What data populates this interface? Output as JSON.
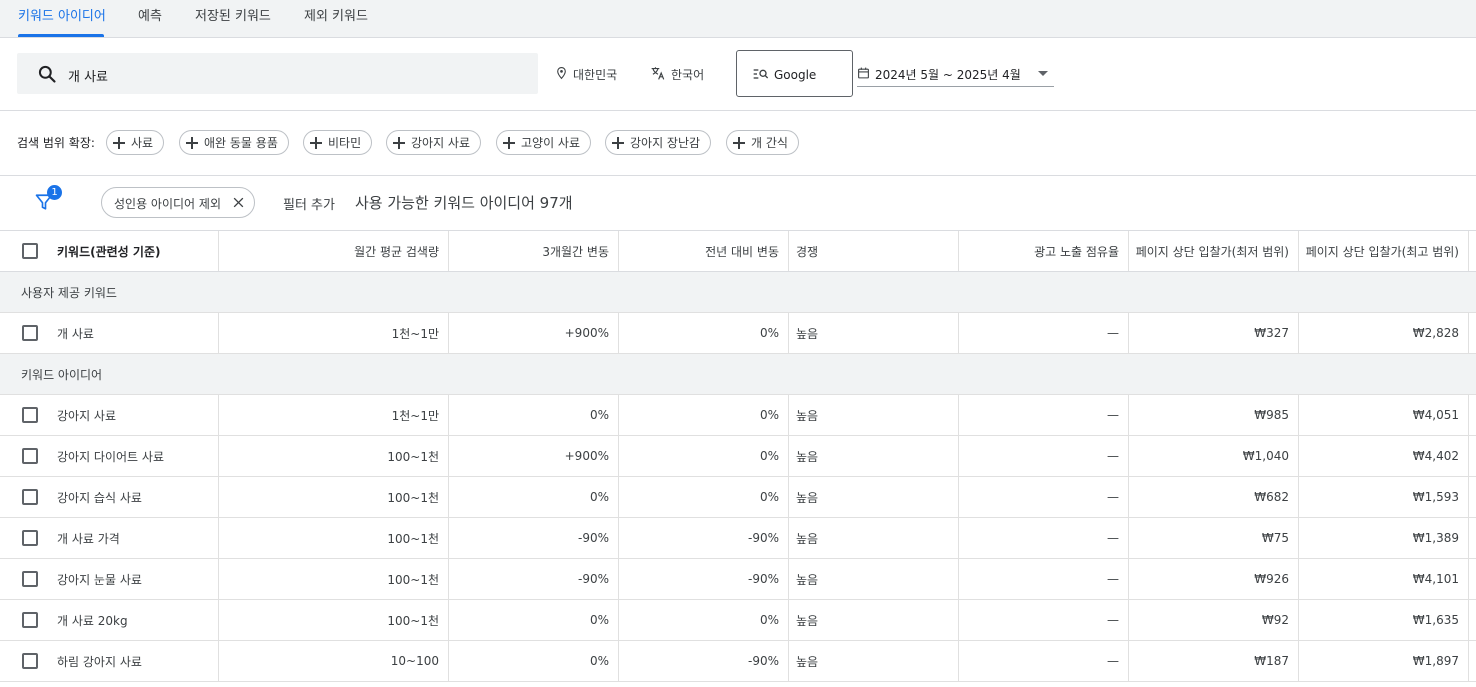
{
  "tabs": [
    {
      "label": "키워드 아이디어",
      "active": true
    },
    {
      "label": "예측",
      "active": false
    },
    {
      "label": "저장된 키워드",
      "active": false
    },
    {
      "label": "제외 키워드",
      "active": false
    }
  ],
  "search": {
    "value": "개 사료",
    "icon": "search-icon"
  },
  "location": {
    "label": "대한민국",
    "icon": "location-pin-icon"
  },
  "language": {
    "label": "한국어",
    "icon": "translate-icon"
  },
  "network": {
    "label": "Google",
    "icon": "search-list-icon"
  },
  "date_range": {
    "label": "2024년 5월 ~ 2025년 4월",
    "icon": "calendar-icon"
  },
  "expand": {
    "label": "검색 범위 확장:",
    "chips": [
      "사료",
      "애완 동물 용품",
      "비타민",
      "강아지 사료",
      "고양이 사료",
      "강아지 장난감",
      "개 간식"
    ]
  },
  "filters": {
    "count_badge": "1",
    "active_filter": "성인용 아이디어 제외",
    "add_filter": "필터 추가",
    "available_text": "사용 가능한 키워드 아이디어 97개"
  },
  "table": {
    "headers": [
      "키워드(관련성 기준)",
      "월간 평균 검색량",
      "3개월간 변동",
      "전년 대비 변동",
      "경쟁",
      "광고 노출 점유율",
      "페이지 상단 입찰가(최저 범위)",
      "페이지 상단 입찰가(최고 범위)"
    ],
    "groups": [
      {
        "label": "사용자 제공 키워드",
        "rows": [
          {
            "keyword": "개 사료",
            "volume": "1천~1만",
            "three_month": "+900%",
            "yoy": "0%",
            "competition": "높음",
            "impression_share": "—",
            "bid_low": "₩327",
            "bid_high": "₩2,828"
          }
        ]
      },
      {
        "label": "키워드 아이디어",
        "rows": [
          {
            "keyword": "강아지 사료",
            "volume": "1천~1만",
            "three_month": "0%",
            "yoy": "0%",
            "competition": "높음",
            "impression_share": "—",
            "bid_low": "₩985",
            "bid_high": "₩4,051"
          },
          {
            "keyword": "강아지 다이어트 사료",
            "volume": "100~1천",
            "three_month": "+900%",
            "yoy": "0%",
            "competition": "높음",
            "impression_share": "—",
            "bid_low": "₩1,040",
            "bid_high": "₩4,402"
          },
          {
            "keyword": "강아지 습식 사료",
            "volume": "100~1천",
            "three_month": "0%",
            "yoy": "0%",
            "competition": "높음",
            "impression_share": "—",
            "bid_low": "₩682",
            "bid_high": "₩1,593"
          },
          {
            "keyword": "개 사료 가격",
            "volume": "100~1천",
            "three_month": "-90%",
            "yoy": "-90%",
            "competition": "높음",
            "impression_share": "—",
            "bid_low": "₩75",
            "bid_high": "₩1,389"
          },
          {
            "keyword": "강아지 눈물 사료",
            "volume": "100~1천",
            "three_month": "-90%",
            "yoy": "-90%",
            "competition": "높음",
            "impression_share": "—",
            "bid_low": "₩926",
            "bid_high": "₩4,101"
          },
          {
            "keyword": "개 사료 20kg",
            "volume": "100~1천",
            "three_month": "0%",
            "yoy": "0%",
            "competition": "높음",
            "impression_share": "—",
            "bid_low": "₩92",
            "bid_high": "₩1,635"
          },
          {
            "keyword": "하림 강아지 사료",
            "volume": "10~100",
            "three_month": "0%",
            "yoy": "-90%",
            "competition": "높음",
            "impression_share": "—",
            "bid_low": "₩187",
            "bid_high": "₩1,897"
          }
        ]
      }
    ]
  },
  "colors": {
    "accent": "#1a73e8",
    "group_bg": "#f1f3f4",
    "border": "#dadce0"
  }
}
